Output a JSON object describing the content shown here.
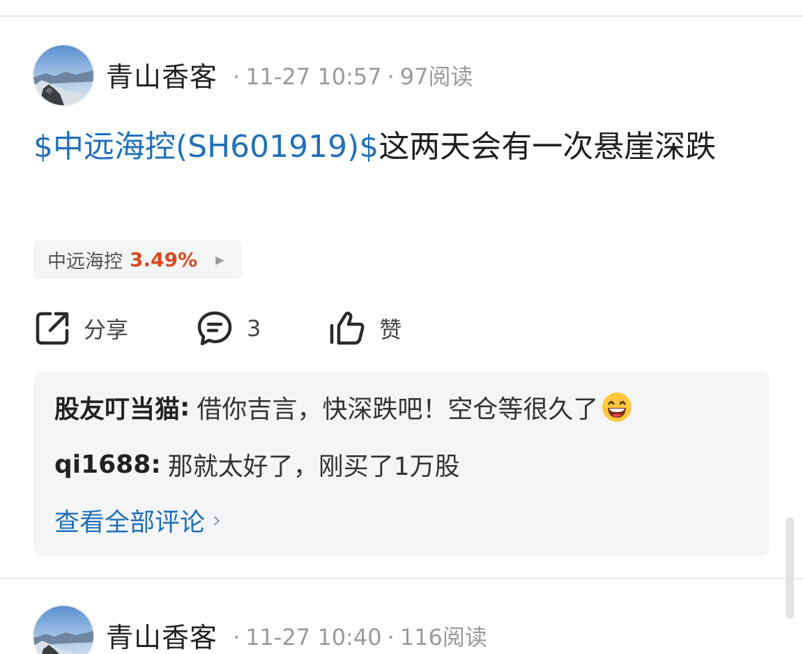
{
  "posts": [
    {
      "author": "青山香客",
      "date": "11-27 10:57",
      "reads": "97阅读",
      "stock_link": "$中远海控(SH601919)$",
      "text": "这两天会有一次悬崖深跌",
      "stock_chip": {
        "name": "中远海控",
        "change": "3.49%"
      },
      "actions": {
        "share": "分享",
        "comment_count": "3",
        "like": "赞"
      },
      "comments": [
        {
          "user": "股友叮当猫",
          "sep": ":",
          "text": "借你吉言，快深跌吧！空仓等很久了"
        },
        {
          "user": "qi1688",
          "sep": ":",
          "text": "那就太好了，刚买了1万股"
        }
      ],
      "view_all": "查看全部评论"
    },
    {
      "author": "青山香客",
      "date": "11-27 10:40",
      "reads": "116阅读"
    }
  ],
  "colors": {
    "link": "#2070b8",
    "up": "#d9481f",
    "panel": "#f4f5f7"
  },
  "icons": [
    "share-icon",
    "comment-icon",
    "like-icon",
    "grin-emoji-icon",
    "caret-right-icon",
    "chevron-right-icon"
  ]
}
